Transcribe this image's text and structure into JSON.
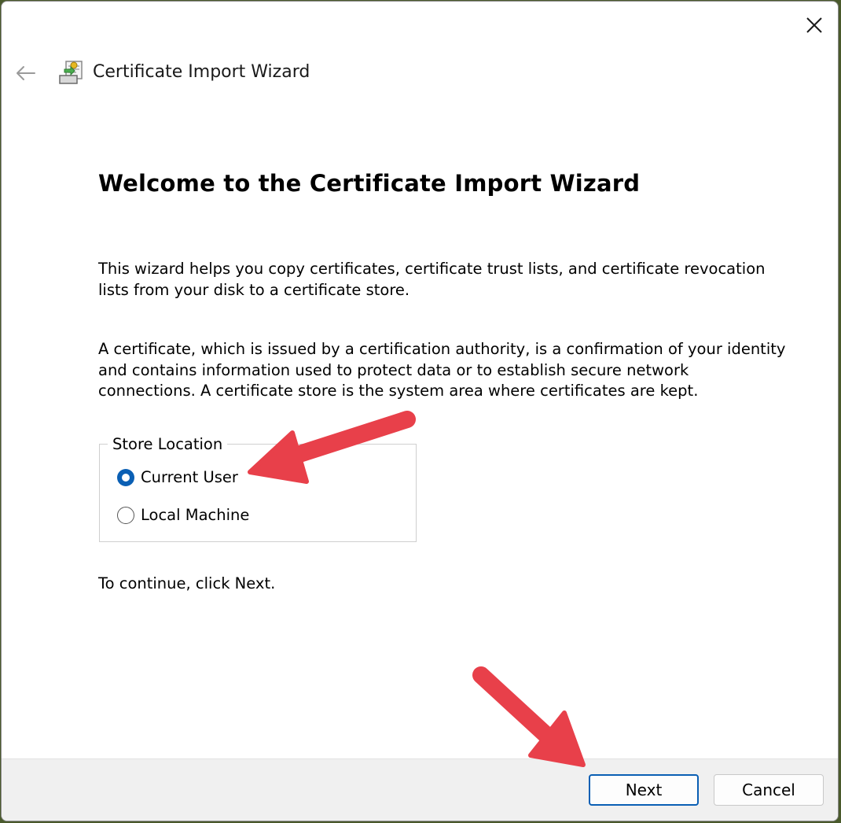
{
  "window": {
    "title": "Certificate Import Wizard"
  },
  "content": {
    "heading": "Welcome to the Certificate Import Wizard",
    "paragraph1": "This wizard helps you copy certificates, certificate trust lists, and certificate revocation\nlists from your disk to a certificate store.",
    "paragraph2": "A certificate, which is issued by a certification authority, is a confirmation of your identity\nand contains information used to protect data or to establish secure network\nconnections. A certificate store is the system area where certificates are kept.",
    "store_location": {
      "legend": "Store Location",
      "options": [
        {
          "label": "Current User",
          "selected": true
        },
        {
          "label": "Local Machine",
          "selected": false
        }
      ]
    },
    "continue_text": "To continue, click Next."
  },
  "footer": {
    "next_label": "Next",
    "cancel_label": "Cancel"
  },
  "colors": {
    "accent": "#0a5fb4",
    "annotation_arrow": "#e8404a"
  },
  "icons": {
    "close": "close-icon",
    "back": "back-arrow-icon",
    "app": "certificate-icon"
  }
}
